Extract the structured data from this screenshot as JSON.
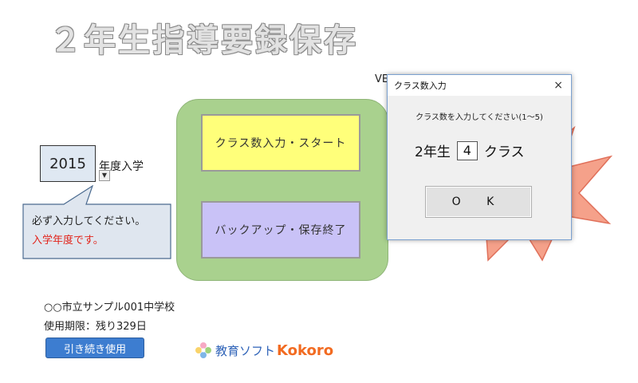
{
  "title": "２年生指導要録保存",
  "version_prefix": "VE",
  "year_input": {
    "value": "2015",
    "suffix": "年度入学"
  },
  "callout": {
    "line1": "必ず入力してください。",
    "line2": "入学年度です。"
  },
  "buttons": {
    "start": "クラス数入力・スタート",
    "backup": "バックアップ・保存終了",
    "continue": "引き続き使用"
  },
  "dialog": {
    "title": "クラス数入力",
    "close": "×",
    "prompt": "クラス数を入力してください(1～5)",
    "grade_label": "2年生",
    "class_count": "4",
    "class_suffix": "クラス",
    "ok": "O K"
  },
  "footer": {
    "school": "○○市立サンプル001中学校",
    "expiry": "使用期限：残り329日"
  },
  "logo": {
    "label": "教育ソフト",
    "brand": "Kokoro"
  },
  "colors": {
    "start_button": "#ffff7a",
    "backup_button": "#c9c2f7",
    "panel": "#a9d18e",
    "burst": "#f5a18a",
    "accent_red": "#e2231a",
    "continue_button": "#3d7dd0"
  }
}
